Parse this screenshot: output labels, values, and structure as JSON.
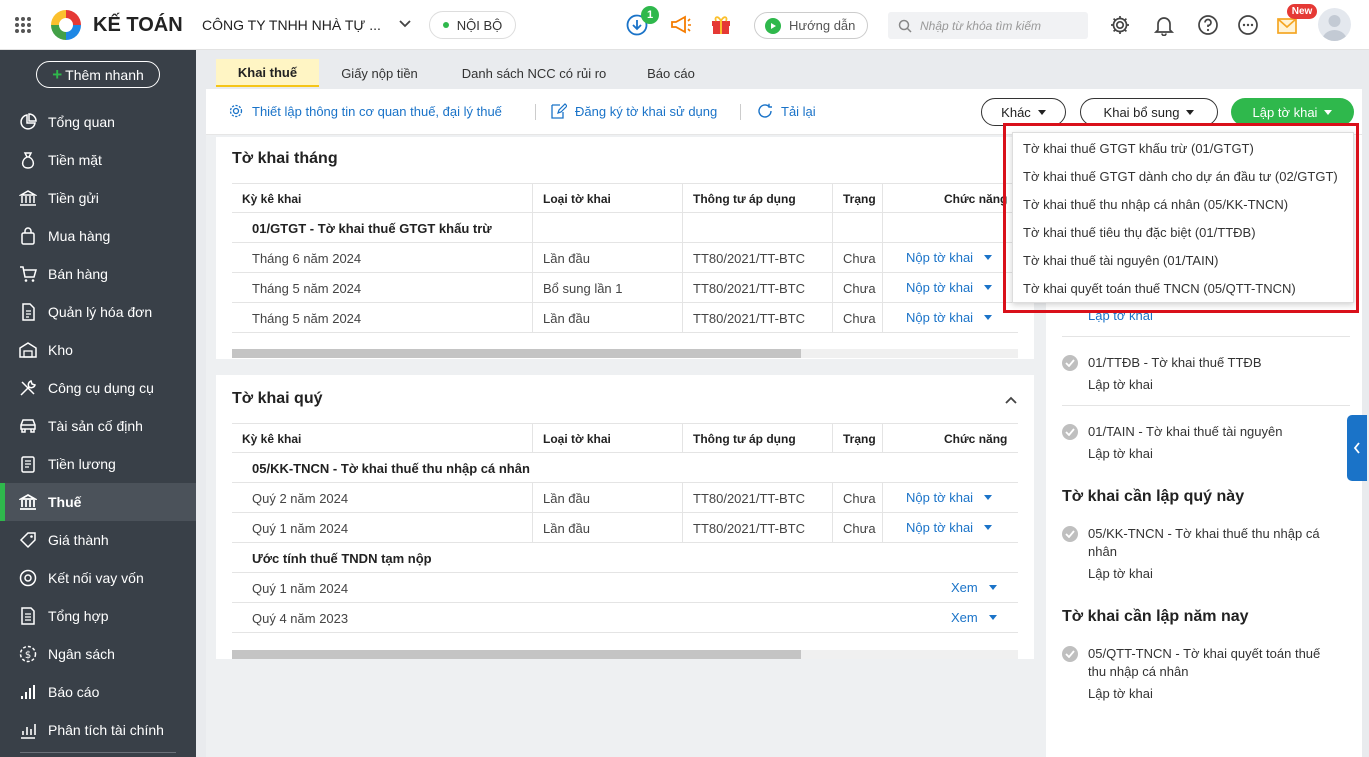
{
  "header": {
    "logo_text": "KẾ TOÁN",
    "company": "CÔNG TY TNHH NHÀ TỰ ...",
    "badge": "NỘI BỘ",
    "notif_count": "1",
    "guide_label": "Hướng dẫn",
    "search_placeholder": "Nhập từ khóa tìm kiếm",
    "new_badge": "New"
  },
  "sidebar": {
    "quick_add": "Thêm nhanh",
    "items": [
      {
        "label": "Tổng quan"
      },
      {
        "label": "Tiền mặt"
      },
      {
        "label": "Tiền gửi"
      },
      {
        "label": "Mua hàng"
      },
      {
        "label": "Bán hàng"
      },
      {
        "label": "Quản lý hóa đơn"
      },
      {
        "label": "Kho"
      },
      {
        "label": "Công cụ dụng cụ"
      },
      {
        "label": "Tài sản cố định"
      },
      {
        "label": "Tiền lương"
      },
      {
        "label": "Thuế"
      },
      {
        "label": "Giá thành"
      },
      {
        "label": "Kết nối vay vốn"
      },
      {
        "label": "Tổng hợp"
      },
      {
        "label": "Ngân sách"
      },
      {
        "label": "Báo cáo"
      },
      {
        "label": "Phân tích tài chính"
      }
    ]
  },
  "tabs": [
    "Khai thuế",
    "Giấy nộp tiền",
    "Danh sách NCC có rủi ro",
    "Báo cáo"
  ],
  "toolbar": {
    "setup": "Thiết lập thông tin cơ quan thuế, đại lý thuế",
    "register": "Đăng ký tờ khai sử dụng",
    "reload": "Tải lại",
    "other": "Khác",
    "supplement": "Khai bổ sung",
    "create": "Lập tờ khai"
  },
  "columns": [
    "Kỳ kê khai",
    "Loại tờ khai",
    "Thông tư áp dụng",
    "Trạng",
    "Chức năng"
  ],
  "monthly": {
    "title": "Tờ khai tháng",
    "group": "01/GTGT - Tờ khai thuế GTGT khấu trừ",
    "rows": [
      {
        "period": "Tháng 6 năm 2024",
        "type": "Lần đầu",
        "circular": "TT80/2021/TT-BTC",
        "status": "Chưa nộp",
        "action": "Nộp tờ khai"
      },
      {
        "period": "Tháng 5 năm 2024",
        "type": "Bổ sung lần 1",
        "circular": "TT80/2021/TT-BTC",
        "status": "Chưa nộp",
        "action": "Nộp tờ khai"
      },
      {
        "period": "Tháng 5 năm 2024",
        "type": "Lần đầu",
        "circular": "TT80/2021/TT-BTC",
        "status": "Chưa nộp",
        "action": "Nộp tờ khai"
      }
    ]
  },
  "quarterly": {
    "title": "Tờ khai quý",
    "group1": "05/KK-TNCN - Tờ khai thuế thu nhập cá nhân",
    "rows1": [
      {
        "period": "Quý 2 năm 2024",
        "type": "Lần đầu",
        "circular": "TT80/2021/TT-BTC",
        "status": "Chưa nộp",
        "action": "Nộp tờ khai"
      },
      {
        "period": "Quý 1 năm 2024",
        "type": "Lần đầu",
        "circular": "TT80/2021/TT-BTC",
        "status": "Chưa nộp",
        "action": "Nộp tờ khai"
      }
    ],
    "group2": "Ước tính thuế TNDN tạm nộp",
    "rows2": [
      {
        "period": "Quý 1 năm 2024",
        "action": "Xem"
      },
      {
        "period": "Quý 4 năm 2023",
        "action": "Xem"
      }
    ]
  },
  "dropdown": [
    "Tờ khai thuế GTGT khấu trừ (01/GTGT)",
    "Tờ khai thuế GTGT dành cho dự án đầu tư (02/GTGT)",
    "Tờ khai thuế thu nhập cá nhân (05/KK-TNCN)",
    "Tờ khai thuế tiêu thụ đặc biệt (01/TTĐB)",
    "Tờ khai thuế tài nguyên (01/TAIN)",
    "Tờ khai quyết toán thuế TNCN (05/QTT-TNCN)"
  ],
  "right_panel": {
    "partial_link": "Lập tờ khai",
    "month_items": [
      {
        "title": "01/TTĐB - Tờ khai thuế TTĐB",
        "link": "Lập tờ khai"
      },
      {
        "title": "01/TAIN - Tờ khai thuế tài nguyên",
        "link": "Lập tờ khai"
      }
    ],
    "quarter_heading": "Tờ khai cần lập quý này",
    "quarter_item": {
      "title_l1": "05/KK-TNCN - Tờ khai thuế thu nhập cá",
      "title_l2": "nhân",
      "link": "Lập tờ khai"
    },
    "year_heading": "Tờ khai cần lập năm nay",
    "year_item": {
      "title_l1": "05/QTT-TNCN - Tờ khai quyết toán thuế",
      "title_l2": "thu nhập cá nhân",
      "link": "Lập tờ khai"
    }
  },
  "colors": {
    "accent_green": "#2fb84c",
    "link_blue": "#1a73c8",
    "sidebar_bg": "#394048",
    "highlight_red": "#d9101a"
  }
}
